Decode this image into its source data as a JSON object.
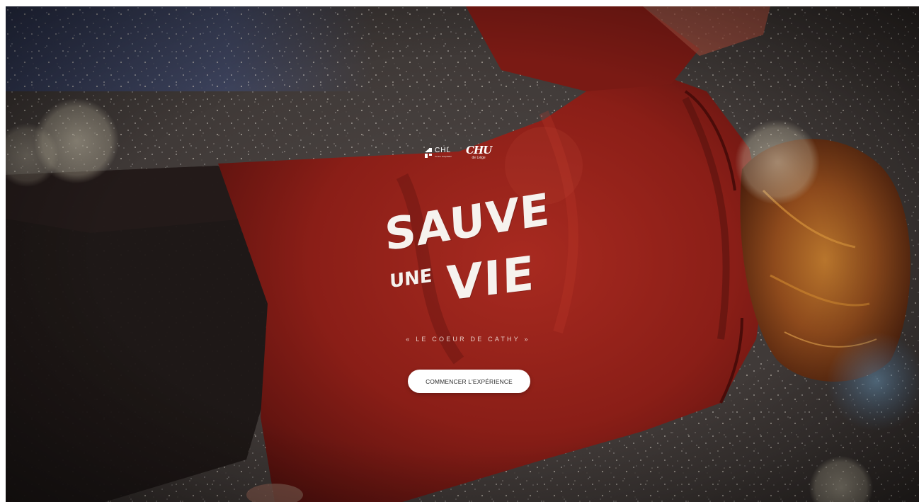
{
  "logos": {
    "chl": {
      "main": "CHL",
      "sub": "Centre Hospitalier de Luxembourg"
    },
    "chu": {
      "main": "CHU",
      "sub": "de Liège"
    }
  },
  "hero": {
    "title_line1": "SAUVE",
    "title_line2a": "UNE",
    "title_line2b": "VIE",
    "subtitle": "« LE COEUR DE CATHY »",
    "cta_label": "COMMENCER L'EXPÉRIENCE"
  },
  "colors": {
    "jacket": "#8e1f18",
    "floor": "#4a4442",
    "title_text": "#f6f2ee",
    "button_bg": "#ffffff"
  },
  "icons": {
    "chl_logo": "chl-logo-icon",
    "chu_logo": "chu-logo-icon"
  }
}
